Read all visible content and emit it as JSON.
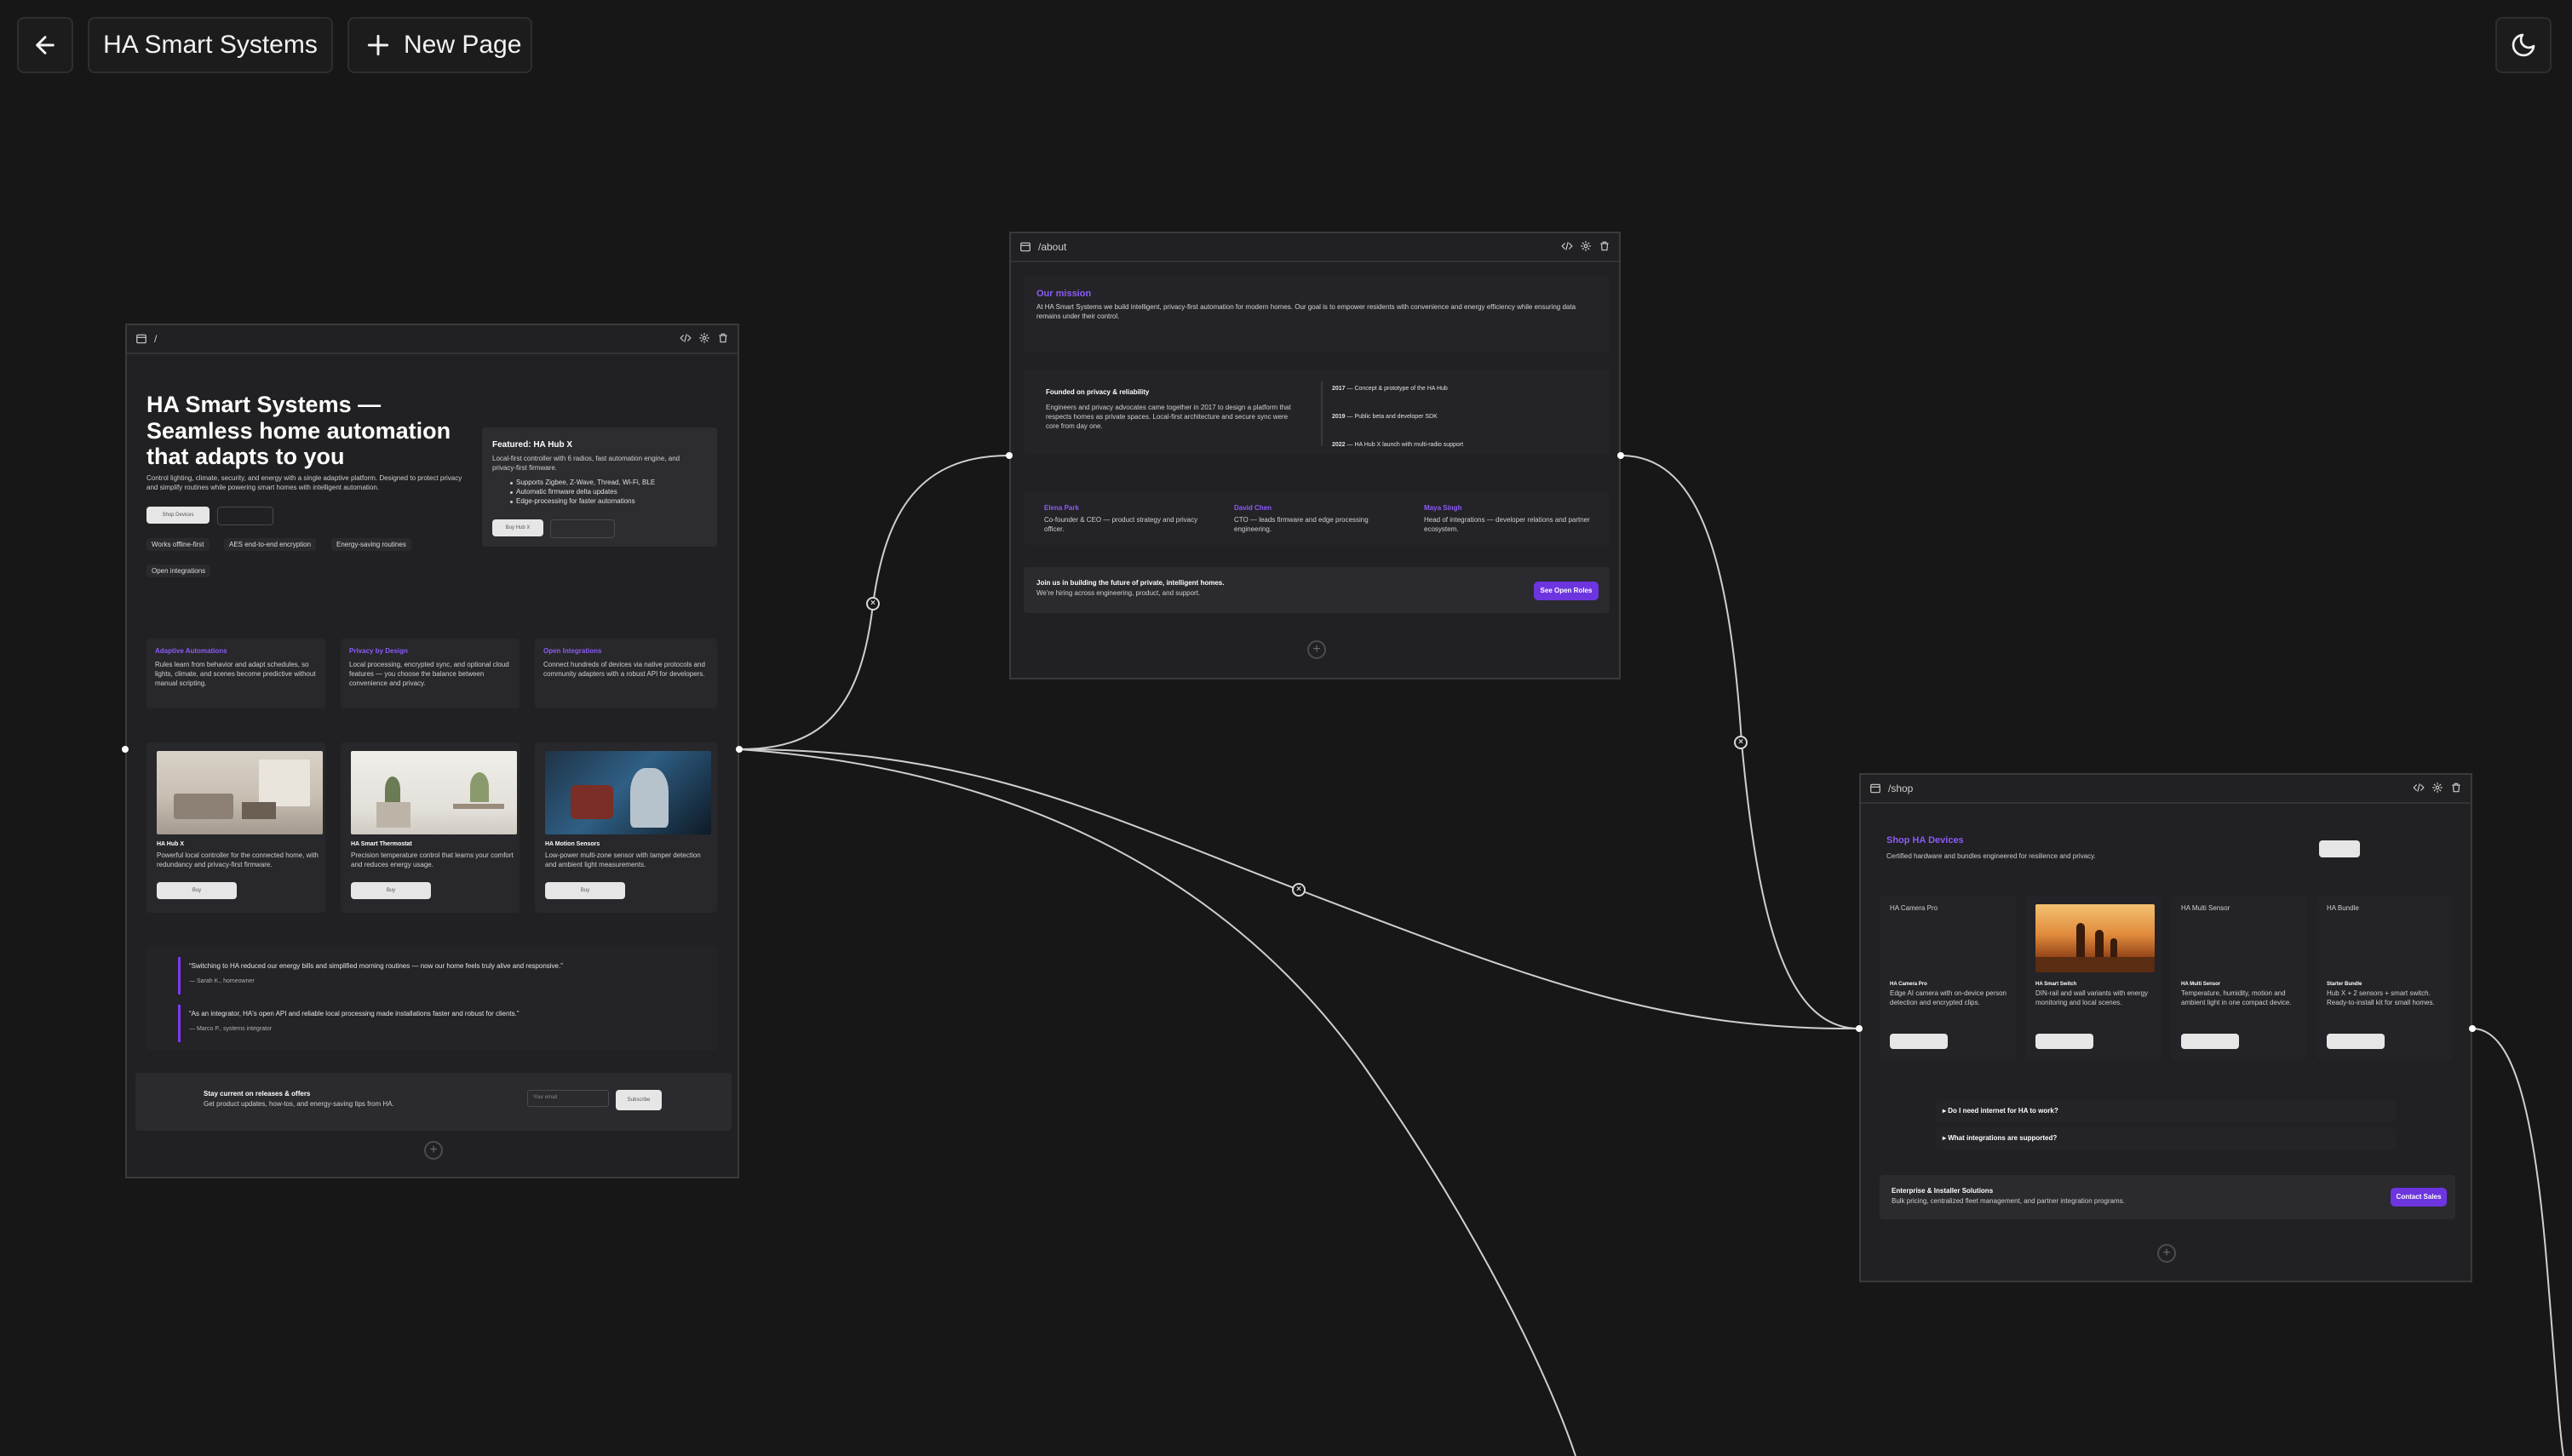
{
  "app": {
    "project_name": "HA Smart Systems",
    "new_page_label": "New Page"
  },
  "colors": {
    "accent": "#7c3aed",
    "canvas": "#171717",
    "node": "#212022"
  },
  "home": {
    "route": "/",
    "hero_title": "HA Smart Systems — Seamless home automation that adapts to you",
    "hero_sub": "Control lighting, climate, security, and energy with a single adaptive platform. Designed to protect privacy and simplify routines while powering smart homes with intelligent automation.",
    "primary_cta": "Shop Devices",
    "featured_title": "Featured: HA Hub X",
    "featured_desc": "Local-first controller with 6 radios, fast automation engine, and privacy-first firmware.",
    "featured_bullets": [
      "Supports Zigbee, Z-Wave, Thread, Wi-Fi, BLE",
      "Automatic firmware delta updates",
      "Edge-processing for faster automations"
    ],
    "featured_cta": "Buy Hub X",
    "pills": [
      "Works offline-first",
      "AES end-to-end encryption",
      "Energy-saving routines",
      "Open integrations"
    ],
    "features": [
      {
        "title": "Adaptive Automations",
        "desc": "Rules learn from behavior and adapt schedules, so lights, climate, and scenes become predictive without manual scripting."
      },
      {
        "title": "Privacy by Design",
        "desc": "Local processing, encrypted sync, and optional cloud features — you choose the balance between convenience and privacy."
      },
      {
        "title": "Open Integrations",
        "desc": "Connect hundreds of devices via native protocols and community adapters with a robust API for developers."
      }
    ],
    "products": [
      {
        "name": "HA Hub X",
        "desc": "Powerful local controller for the connected home, with redundancy and privacy-first firmware.",
        "cta": "Buy"
      },
      {
        "name": "HA Smart Thermostat",
        "desc": "Precision temperature control that learns your comfort and reduces energy usage.",
        "cta": "Buy"
      },
      {
        "name": "HA Motion Sensors",
        "desc": "Low-power multi-zone sensor with tamper detection and ambient light measurements.",
        "cta": "Buy"
      }
    ],
    "testimonials": [
      {
        "quote": "“Switching to HA reduced our energy bills and simplified morning routines — now our home feels truly alive and responsive.”",
        "author": "— Sarah K., homeowner"
      },
      {
        "quote": "“As an integrator, HA's open API and reliable local processing made installations faster and robust for clients.”",
        "author": "— Marco P., systems integrator"
      }
    ],
    "newsletter_title": "Stay current on releases & offers",
    "newsletter_sub": "Get product updates, how-tos, and energy-saving tips from HA.",
    "email_placeholder": "Your email",
    "subscribe_label": "Subscribe"
  },
  "about": {
    "route": "/about",
    "mission_title": "Our mission",
    "mission_text": "At HA Smart Systems we build intelligent, privacy-first automation for modern homes. Our goal is to empower residents with convenience and energy efficiency while ensuring data remains under their control.",
    "founded_title": "Founded on privacy & reliability",
    "founded_text": "Engineers and privacy advocates came together in 2017 to design a platform that respects homes as private spaces. Local-first architecture and secure sync were core from day one.",
    "timeline": [
      {
        "year": "2017",
        "text": " — Concept & prototype of the HA Hub"
      },
      {
        "year": "2019",
        "text": " — Public beta and developer SDK"
      },
      {
        "year": "2022",
        "text": " — HA Hub X launch with multi-radio support"
      }
    ],
    "team": [
      {
        "name": "Elena Park",
        "role": "Co-founder & CEO — product strategy and privacy officer."
      },
      {
        "name": "David Chen",
        "role": "CTO — leads firmware and edge processing engineering."
      },
      {
        "name": "Maya Singh",
        "role": "Head of integrations — developer relations and partner ecosystem."
      }
    ],
    "join_title": "Join us in building the future of private, intelligent homes.",
    "join_sub": "We're hiring across engineering, product, and support.",
    "join_cta": "See Open Roles"
  },
  "shop": {
    "route": "/shop",
    "title": "Shop HA Devices",
    "subtitle": "Certified hardware and bundles engineered for resilience and privacy.",
    "products": [
      {
        "alt": "HA Camera Pro",
        "name": "HA Camera Pro",
        "desc": "Edge AI camera with on-device person detection and encrypted clips."
      },
      {
        "alt": "",
        "name": "HA Smart Switch",
        "desc": "DIN-rail and wall variants with energy monitoring and local scenes."
      },
      {
        "alt": "HA Multi Sensor",
        "name": "HA Multi Sensor",
        "desc": "Temperature, humidity, motion and ambient light in one compact device."
      },
      {
        "alt": "HA Bundle",
        "name": "Starter Bundle",
        "desc": "Hub X + 2 sensors + smart switch. Ready-to-install kit for small homes."
      }
    ],
    "faq": [
      "▸ Do I need internet for HA to work?",
      "▸ What integrations are supported?"
    ],
    "enterprise_title": "Enterprise & Installer Solutions",
    "enterprise_sub": "Bulk pricing, centralized fleet management, and partner integration programs.",
    "enterprise_cta": "Contact Sales"
  }
}
